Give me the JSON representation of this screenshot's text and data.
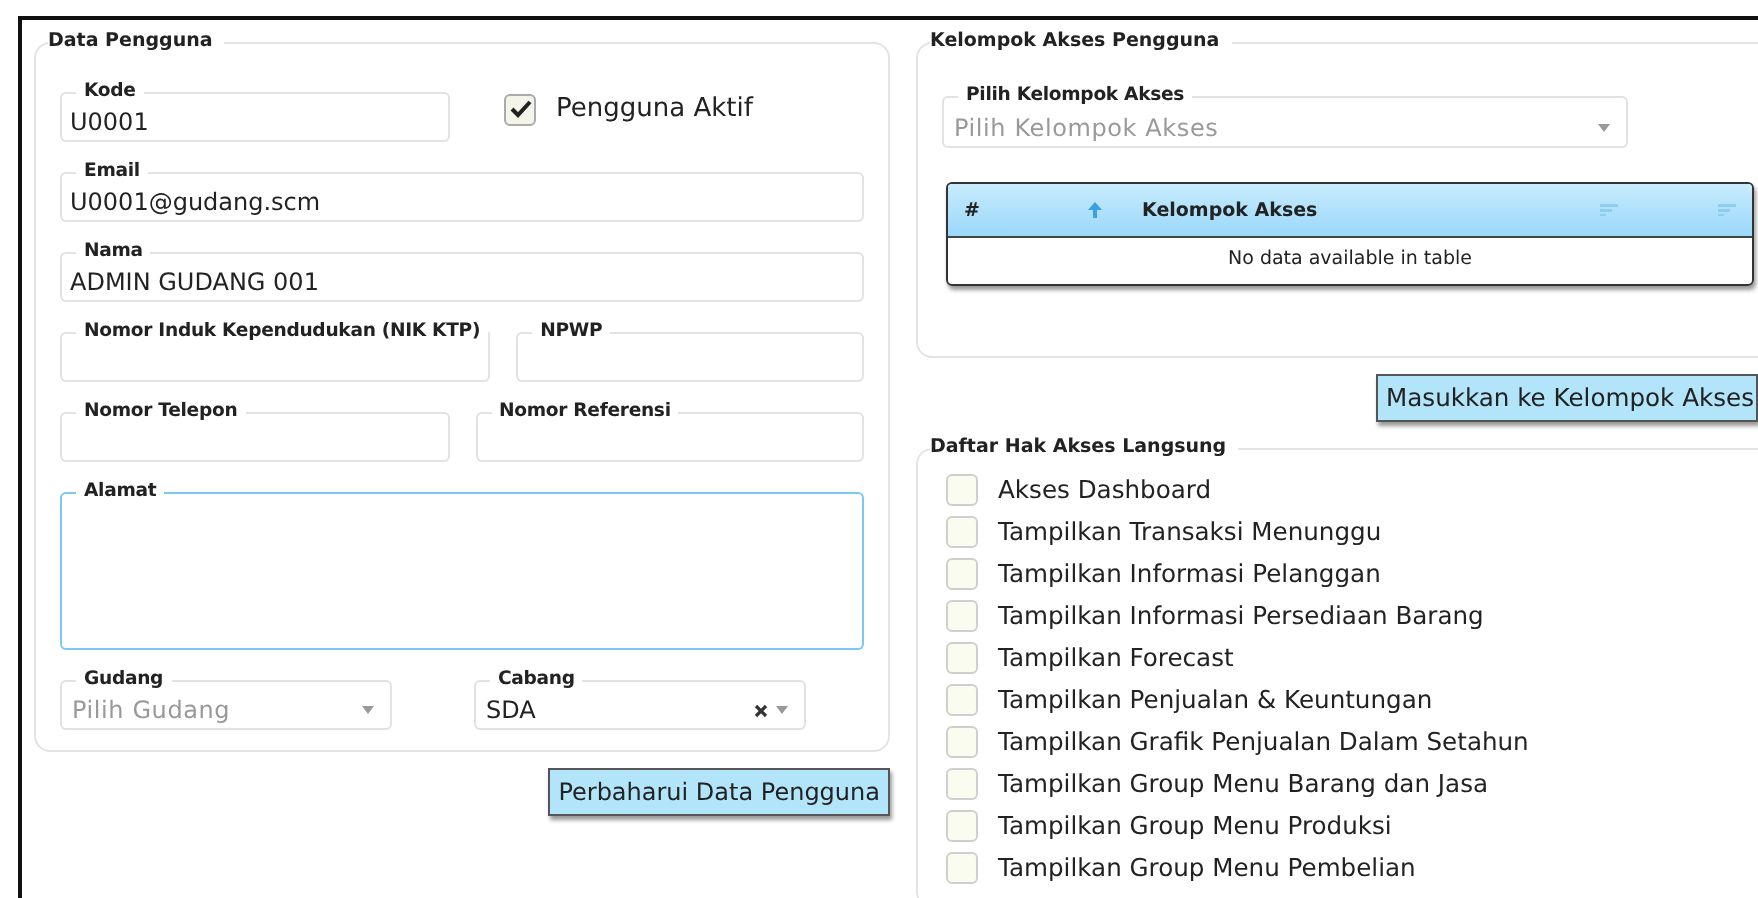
{
  "user_panel": {
    "title": "Data Pengguna",
    "rows": [
      [
        {
          "kind": "text",
          "label": "Kode",
          "value": "U0001"
        },
        {
          "kind": "checkbox",
          "label": "Pengguna Aktif",
          "checked": true
        }
      ],
      [
        {
          "kind": "text",
          "label": "Email",
          "value": "U0001@gudang.scm"
        }
      ],
      [
        {
          "kind": "text",
          "label": "Nama",
          "value": "ADMIN GUDANG 001"
        }
      ],
      [
        {
          "kind": "text",
          "label": "Nomor Induk Kependudukan (NIK KTP)"
        },
        {
          "kind": "text",
          "label": "NPWP"
        }
      ],
      [
        {
          "kind": "text",
          "label": "Nomor Telepon"
        },
        {
          "kind": "text",
          "label": "Nomor Referensi"
        }
      ],
      [
        {
          "kind": "textarea",
          "label": "Alamat",
          "focused": true
        }
      ],
      [
        {
          "kind": "select",
          "label": "Gudang",
          "placeholder": "Pilih Gudang"
        },
        {
          "kind": "select",
          "label": "Cabang",
          "value": "SDA",
          "clearable": true
        }
      ]
    ],
    "button": "Perbaharui Data Pengguna"
  },
  "group_panel": {
    "title": "Kelompok Akses Pengguna",
    "select": {
      "label": "Pilih Kelompok Akses",
      "placeholder": "Pilih Kelompok Akses"
    },
    "table": {
      "columns": [
        "#",
        "Kelompok Akses"
      ],
      "empty": "No data available in table"
    },
    "button": "Masukkan ke Kelompok Akses"
  },
  "rights_panel": {
    "title": "Daftar Hak Akses Langsung",
    "items": [
      {
        "label": "Akses Dashboard",
        "checked": false
      },
      {
        "label": "Tampilkan Transaksi Menunggu",
        "checked": false
      },
      {
        "label": "Tampilkan Informasi Pelanggan",
        "checked": false
      },
      {
        "label": "Tampilkan Informasi Persediaan Barang",
        "checked": false
      },
      {
        "label": "Tampilkan Forecast",
        "checked": false
      },
      {
        "label": "Tampilkan Penjualan & Keuntungan",
        "checked": false
      },
      {
        "label": "Tampilkan Grafik Penjualan Dalam Setahun",
        "checked": false
      },
      {
        "label": "Tampilkan Group Menu Barang dan Jasa",
        "checked": false
      },
      {
        "label": "Tampilkan Group Menu Produksi",
        "checked": false
      },
      {
        "label": "Tampilkan Group Menu Pembelian",
        "checked": false
      }
    ]
  }
}
